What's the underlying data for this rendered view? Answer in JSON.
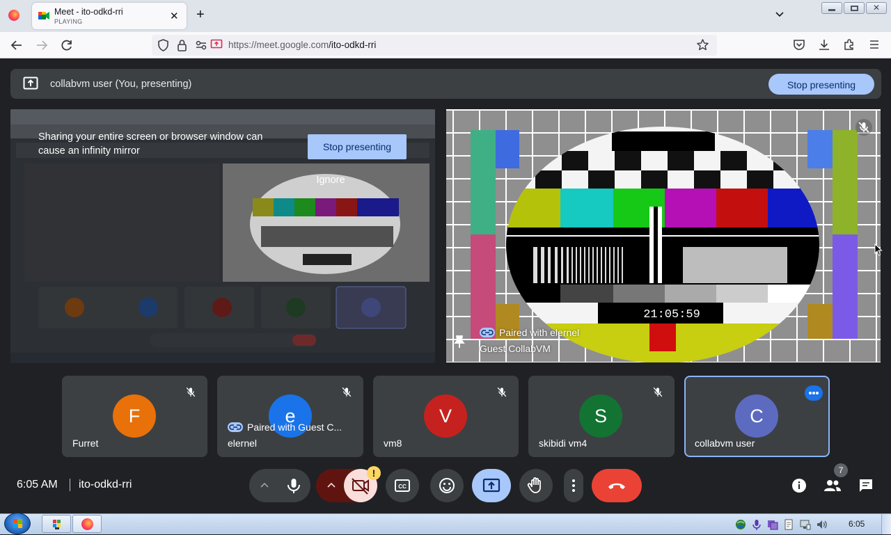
{
  "browser": {
    "tab_title": "Meet - ito-odkd-rri",
    "tab_status": "PLAYING",
    "url_host": "https://meet.google.com",
    "url_path": "/ito-odkd-rri"
  },
  "banner": {
    "text": "collabvm user (You, presenting)",
    "stop_label": "Stop presenting"
  },
  "mirror": {
    "warning": "Sharing your entire screen or browser window can cause an infinity mirror",
    "stop_label": "Stop presenting",
    "ignore_label": "Ignore"
  },
  "presenter_tile": {
    "paired_text": "Paired with elernel",
    "name": "Guest CollabVM",
    "clock": "21:05:59"
  },
  "participants": [
    {
      "initial": "F",
      "name": "Furret",
      "color": "#e8710a"
    },
    {
      "initial": "e",
      "name": "elernel",
      "color": "#1a73e8",
      "paired": "Paired with Guest C..."
    },
    {
      "initial": "V",
      "name": "vm8",
      "color": "#c5221f"
    },
    {
      "initial": "S",
      "name": "skibidi vm4",
      "color": "#137333"
    },
    {
      "initial": "C",
      "name": "collabvm user",
      "color": "#5c6bc0"
    }
  ],
  "bottom": {
    "time": "6:05 AM",
    "meeting_code": "ito-odkd-rri",
    "people_count": "7"
  },
  "taskbar": {
    "clock": "6:05"
  },
  "colors": {
    "accent_blue": "#a8c7fa",
    "leave_red": "#ea4335",
    "camera_off": "#f9dedc"
  }
}
